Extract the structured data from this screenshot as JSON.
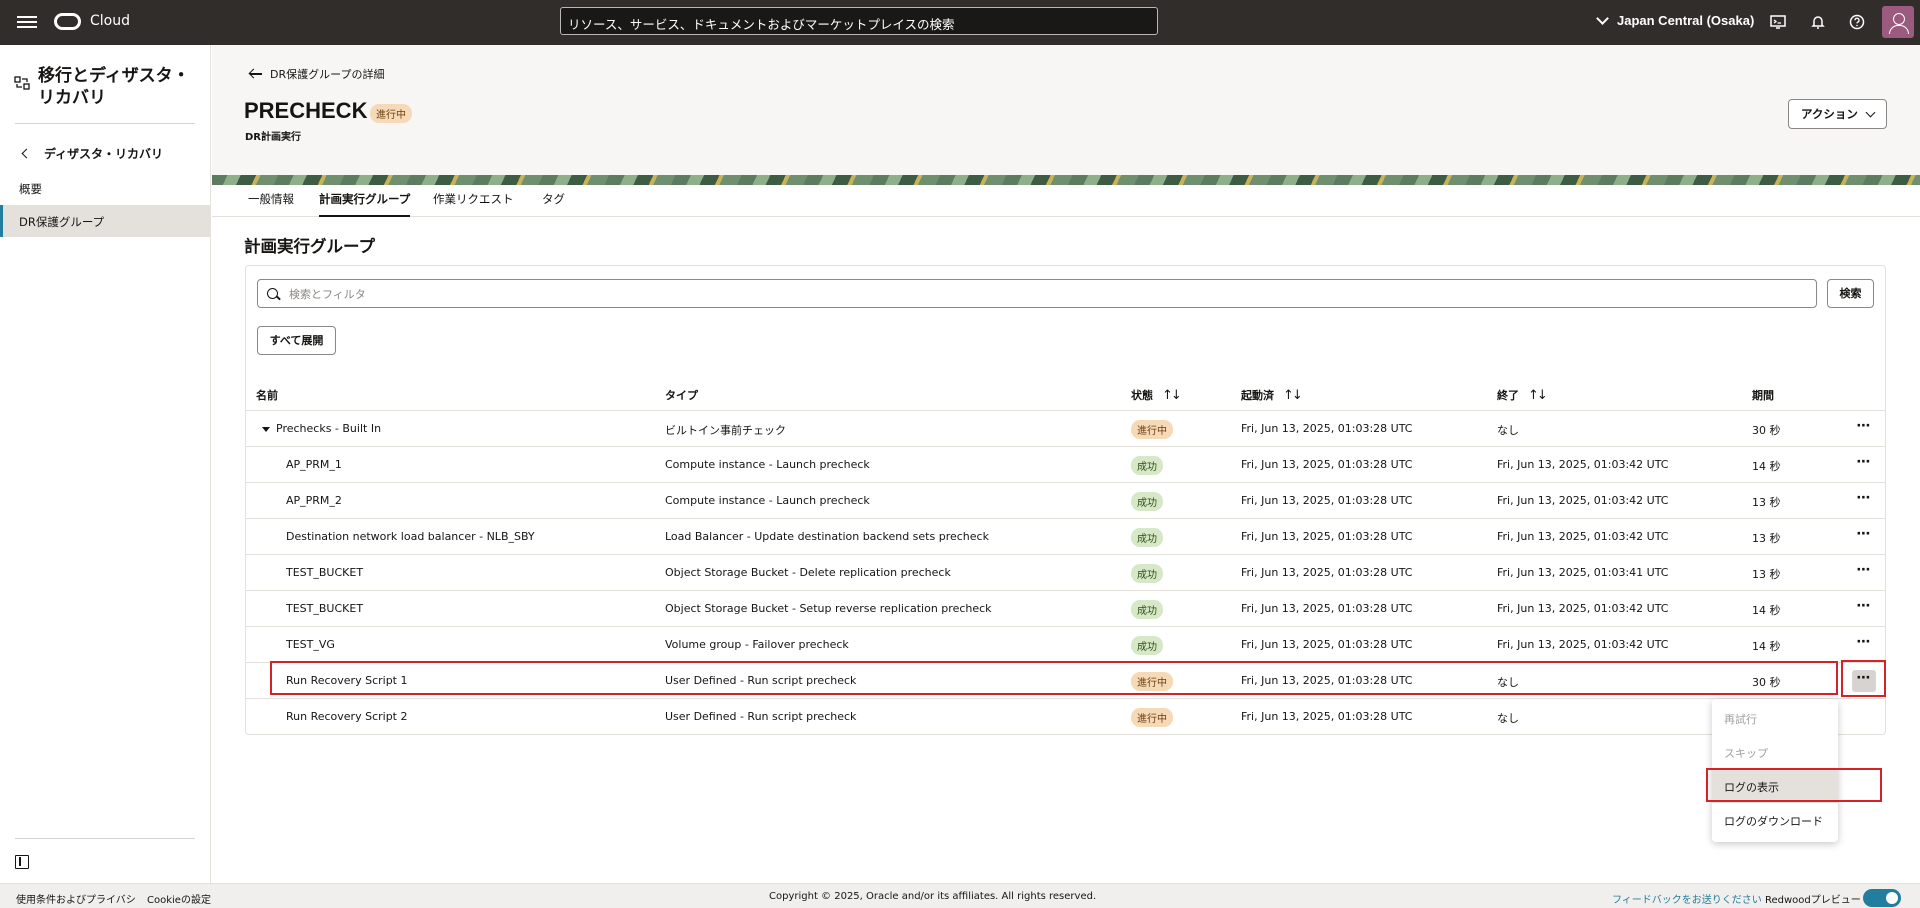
{
  "header": {
    "brand": "Cloud",
    "search_placeholder": "リソース、サービス、ドキュメントおよびマーケットプレイスの検索",
    "region": "Japan Central (Osaka)"
  },
  "sidebar": {
    "title": "移行とディザスタ・リカバリ",
    "back_label": "ディザスタ・リカバリ",
    "items": [
      {
        "label": "概要"
      },
      {
        "label": "DR保護グループ"
      }
    ]
  },
  "page": {
    "back_link": "DR保護グループの詳細",
    "title": "PRECHECK",
    "status": "進行中",
    "subtitle": "DR計画実行",
    "action_label": "アクション"
  },
  "tabs": [
    {
      "label": "一般情報"
    },
    {
      "label": "計画実行グループ"
    },
    {
      "label": "作業リクエスト"
    },
    {
      "label": "タグ"
    }
  ],
  "section": {
    "title": "計画実行グループ",
    "search_placeholder": "検索とフィルタ",
    "search_button": "検索",
    "expand_all": "すべて展開"
  },
  "table": {
    "columns": [
      "名前",
      "タイプ",
      "状態",
      "起動済",
      "終了",
      "期間"
    ],
    "rows": [
      {
        "name": "Prechecks - Built In",
        "type": "ビルトイン事前チェック",
        "state": "進行中",
        "started": "Fri, Jun 13, 2025, 01:03:28 UTC",
        "ended": "なし",
        "duration": "30 秒"
      },
      {
        "name": "AP_PRM_1",
        "type": "Compute instance - Launch precheck",
        "state": "成功",
        "started": "Fri, Jun 13, 2025, 01:03:28 UTC",
        "ended": "Fri, Jun 13, 2025, 01:03:42 UTC",
        "duration": "14 秒"
      },
      {
        "name": "AP_PRM_2",
        "type": "Compute instance - Launch precheck",
        "state": "成功",
        "started": "Fri, Jun 13, 2025, 01:03:28 UTC",
        "ended": "Fri, Jun 13, 2025, 01:03:42 UTC",
        "duration": "13 秒"
      },
      {
        "name": "Destination network load balancer - NLB_SBY",
        "type": "Load Balancer - Update destination backend sets precheck",
        "state": "成功",
        "started": "Fri, Jun 13, 2025, 01:03:28 UTC",
        "ended": "Fri, Jun 13, 2025, 01:03:42 UTC",
        "duration": "13 秒"
      },
      {
        "name": "TEST_BUCKET",
        "type": "Object Storage Bucket - Delete replication precheck",
        "state": "成功",
        "started": "Fri, Jun 13, 2025, 01:03:28 UTC",
        "ended": "Fri, Jun 13, 2025, 01:03:41 UTC",
        "duration": "13 秒"
      },
      {
        "name": "TEST_BUCKET",
        "type": "Object Storage Bucket - Setup reverse replication precheck",
        "state": "成功",
        "started": "Fri, Jun 13, 2025, 01:03:28 UTC",
        "ended": "Fri, Jun 13, 2025, 01:03:42 UTC",
        "duration": "14 秒"
      },
      {
        "name": "TEST_VG",
        "type": "Volume group - Failover precheck",
        "state": "成功",
        "started": "Fri, Jun 13, 2025, 01:03:28 UTC",
        "ended": "Fri, Jun 13, 2025, 01:03:42 UTC",
        "duration": "14 秒"
      },
      {
        "name": "Run Recovery Script 1",
        "type": "User Defined - Run script precheck",
        "state": "進行中",
        "started": "Fri, Jun 13, 2025, 01:03:28 UTC",
        "ended": "なし",
        "duration": "30 秒"
      },
      {
        "name": "Run Recovery Script 2",
        "type": "User Defined - Run script precheck",
        "state": "進行中",
        "started": "Fri, Jun 13, 2025, 01:03:28 UTC",
        "ended": "なし",
        "duration": ""
      }
    ]
  },
  "menu": {
    "items": [
      {
        "label": "再試行"
      },
      {
        "label": "スキップ"
      },
      {
        "label": "ログの表示"
      },
      {
        "label": "ログのダウンロード"
      }
    ]
  },
  "footer": {
    "terms": "使用条件およびプライバシ",
    "cookies": "Cookieの設定",
    "copyright": "Copyright © 2025, Oracle and/or its affiliates. All rights reserved.",
    "feedback": "フィードバックをお送りください",
    "preview": "Redwoodプレビュー"
  },
  "colors": {
    "header_bg": "#312d2a",
    "accent": "#227e9e",
    "highlight": "#d3222a",
    "status_progress": "#f6d9b7",
    "status_success": "#d7e8c8"
  }
}
